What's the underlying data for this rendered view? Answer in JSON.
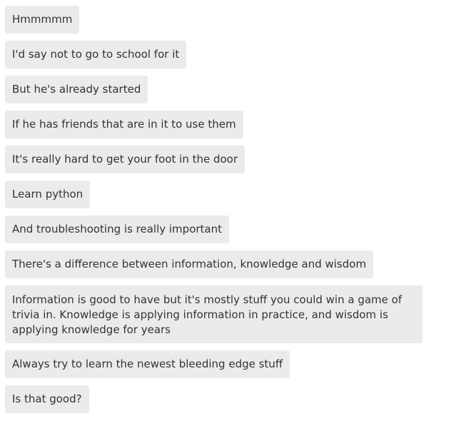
{
  "messages": [
    {
      "text": "Hmmmmm"
    },
    {
      "text": "I'd say not to go to school for it"
    },
    {
      "text": "But he's already started"
    },
    {
      "text": "If he has friends that are in it to use them"
    },
    {
      "text": "It's really hard to get your foot in the door"
    },
    {
      "text": "Learn python"
    },
    {
      "text": "And troubleshooting is really important"
    },
    {
      "text": "There's a difference between information, knowledge and wisdom"
    },
    {
      "text": "Information is good to have but it's mostly stuff you could win a game of trivia in. Knowledge is applying information in practice, and wisdom is applying knowledge for years"
    },
    {
      "text": "Always try to learn the newest bleeding edge stuff"
    },
    {
      "text": "Is that good?"
    }
  ]
}
